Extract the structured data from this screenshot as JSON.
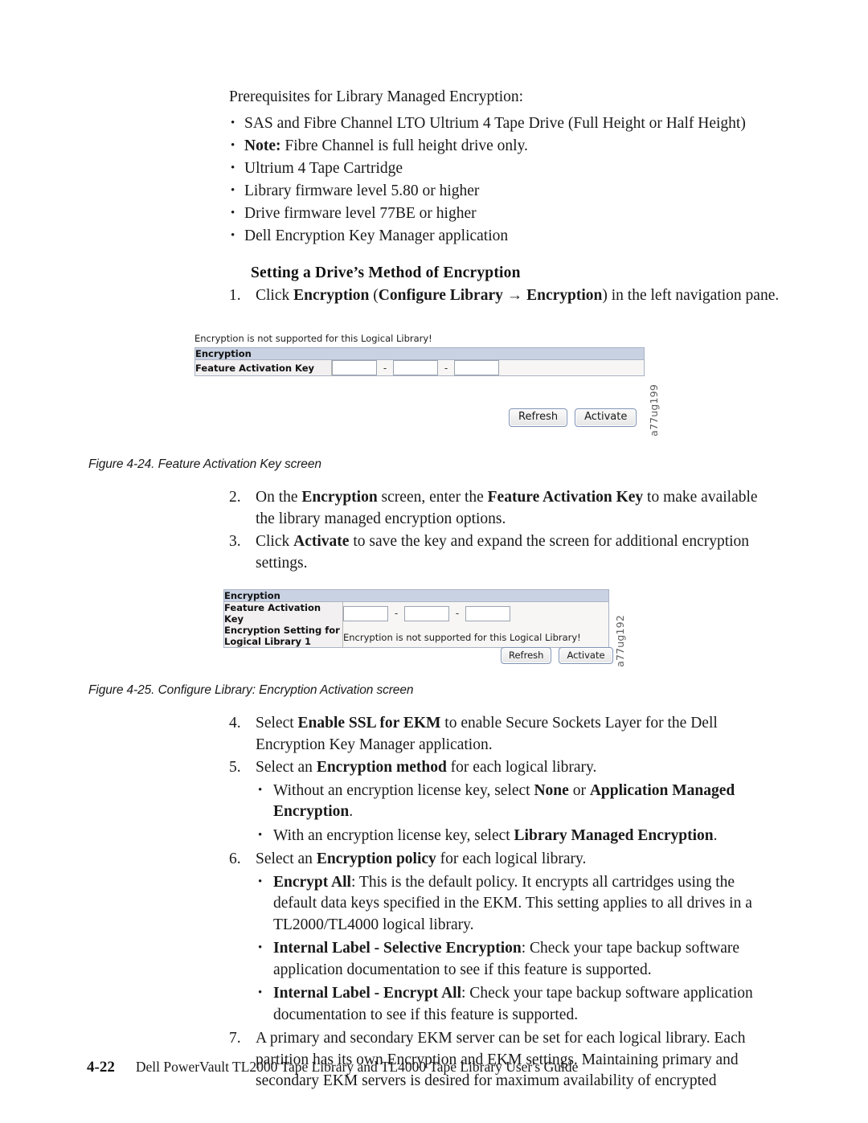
{
  "intro": {
    "lead": "Prerequisites for Library Managed Encryption:",
    "bullets": [
      "SAS and Fibre Channel LTO Ultrium 4 Tape Drive (Full Height or Half Height)"
    ],
    "note_label": "Note:",
    "note_text": "Fibre Channel is full height drive only.",
    "bullets2": [
      "Ultrium 4 Tape Cartridge",
      "Library firmware level 5.80 or higher",
      "Drive firmware level 77BE or higher",
      "Dell Encryption Key Manager application"
    ]
  },
  "section": {
    "heading": "Setting a Drive’s Method of Encryption"
  },
  "steps": {
    "s1": {
      "num": "1.",
      "parts": [
        {
          "t": "Click ",
          "b": false
        },
        {
          "t": "Encryption",
          "b": true
        },
        {
          "t": " (",
          "b": false
        },
        {
          "t": "Configure Library",
          "b": true
        },
        {
          "t": " → ",
          "b": false
        },
        {
          "t": "Encryption",
          "b": true
        },
        {
          "t": ") in the left navigation pane.",
          "b": false
        }
      ]
    },
    "s2": {
      "num": "2.",
      "parts": [
        {
          "t": "On the ",
          "b": false
        },
        {
          "t": "Encryption",
          "b": true
        },
        {
          "t": " screen, enter the ",
          "b": false
        },
        {
          "t": "Feature Activation Key",
          "b": true
        },
        {
          "t": " to make available the library managed encryption options.",
          "b": false
        }
      ]
    },
    "s3": {
      "num": "3.",
      "parts": [
        {
          "t": "Click ",
          "b": false
        },
        {
          "t": "Activate",
          "b": true
        },
        {
          "t": " to save the key and expand the screen for additional encryption settings.",
          "b": false
        }
      ]
    },
    "s4": {
      "num": "4.",
      "parts": [
        {
          "t": "Select ",
          "b": false
        },
        {
          "t": "Enable SSL for EKM",
          "b": true
        },
        {
          "t": " to enable Secure Sockets Layer for the Dell Encryption Key Manager application.",
          "b": false
        }
      ]
    },
    "s5": {
      "num": "5.",
      "parts": [
        {
          "t": "Select an ",
          "b": false
        },
        {
          "t": "Encryption method",
          "b": true
        },
        {
          "t": " for each logical library.",
          "b": false
        }
      ],
      "sub": [
        [
          {
            "t": "Without an encryption license key, select ",
            "b": false
          },
          {
            "t": "None",
            "b": true
          },
          {
            "t": " or ",
            "b": false
          },
          {
            "t": "Application Managed Encryption",
            "b": true
          },
          {
            "t": ".",
            "b": false
          }
        ],
        [
          {
            "t": "With an encryption license key, select ",
            "b": false
          },
          {
            "t": "Library Managed Encryption",
            "b": true
          },
          {
            "t": ".",
            "b": false
          }
        ]
      ]
    },
    "s6": {
      "num": "6.",
      "parts": [
        {
          "t": "Select an ",
          "b": false
        },
        {
          "t": "Encryption policy",
          "b": true
        },
        {
          "t": " for each logical library.",
          "b": false
        }
      ],
      "sub": [
        [
          {
            "t": "Encrypt All",
            "b": true
          },
          {
            "t": ": This is the default policy. It encrypts all cartridges using the default data keys specified in the EKM. This setting applies to all drives in a TL2000/TL4000 logical library.",
            "b": false
          }
        ],
        [
          {
            "t": "Internal Label - Selective Encryption",
            "b": true
          },
          {
            "t": ": Check your tape backup software application documentation to see if this feature is supported.",
            "b": false
          }
        ],
        [
          {
            "t": "Internal Label - Encrypt All",
            "b": true
          },
          {
            "t": ": Check your tape backup software application documentation to see if this feature is supported.",
            "b": false
          }
        ]
      ]
    },
    "s7": {
      "num": "7.",
      "parts": [
        {
          "t": "A primary and secondary EKM server can be set for each logical library. Each partition has its own Encryption and EKM settings. Maintaining primary and secondary EKM servers is desired for maximum availability of encrypted",
          "b": false
        }
      ]
    }
  },
  "figure24": {
    "caption": "Figure 4-24. Feature Activation Key screen",
    "alert": "Encryption is not supported for this Logical Library!",
    "table_header": "Encryption",
    "row_label": "Feature Activation Key",
    "separator": "-",
    "key_field_values": [
      "",
      "",
      ""
    ],
    "buttons": {
      "refresh": "Refresh",
      "activate": "Activate"
    },
    "art_id": "a77ug199"
  },
  "figure25": {
    "caption": "Figure 4-25. Configure Library: Encryption Activation screen",
    "table_header": "Encryption",
    "row1_label": "Feature Activation Key",
    "row2_label_line1": "Encryption Setting for",
    "row2_label_line2": "Logical Library 1",
    "row2_value": "Encryption is not supported for this Logical Library!",
    "separator": "-",
    "key_field_values": [
      "",
      "",
      ""
    ],
    "buttons": {
      "refresh": "Refresh",
      "activate": "Activate"
    },
    "art_id": "a77ug192"
  },
  "footer": {
    "page_number": "4-22",
    "book_title": "Dell PowerVault TL2000 Tape Library and TL4000 Tape Library User's Guide"
  }
}
